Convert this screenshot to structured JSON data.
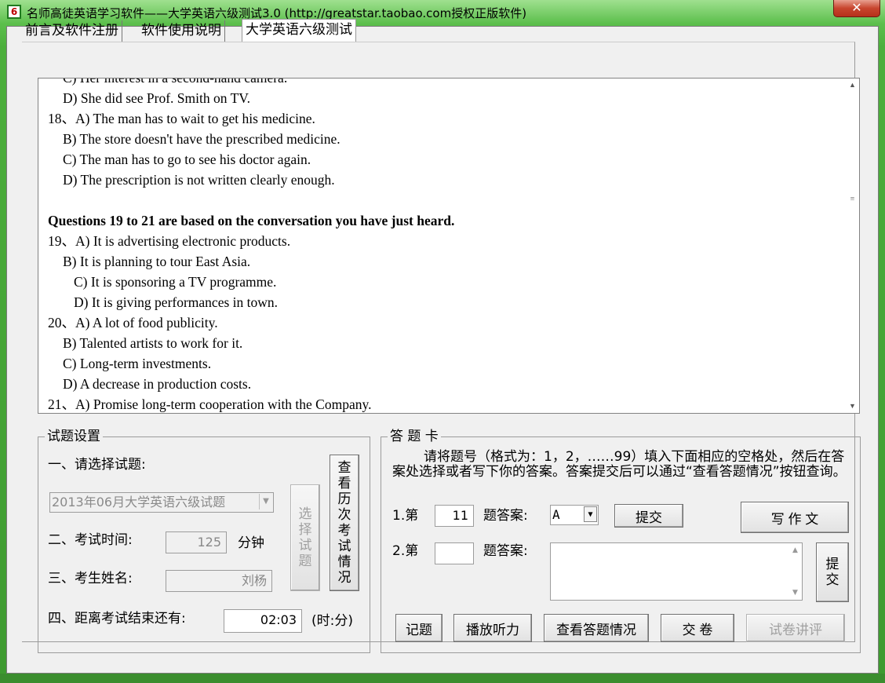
{
  "window": {
    "icon_text": "6",
    "title": "名师高徒英语学习软件——大学英语六级测试3.0 (http://greatstar.taobao.com授权正版软件)",
    "close_glyph": "✕"
  },
  "tabs": [
    {
      "label": "前言及软件注册"
    },
    {
      "label": "软件使用说明"
    },
    {
      "label": "大学英语六级测试"
    }
  ],
  "questions_text": {
    "lines": [
      {
        "text": "C) Her interest in a second-hand camera.",
        "indent": 1,
        "bold": false
      },
      {
        "text": "D) She did see Prof. Smith on TV.",
        "indent": 1,
        "bold": false
      },
      {
        "text": "18、A) The man has to wait to get his medicine.",
        "indent": 0,
        "bold": false
      },
      {
        "text": "B) The store doesn't have the prescribed medicine.",
        "indent": 1,
        "bold": false
      },
      {
        "text": "C) The man has to go to see his doctor again.",
        "indent": 1,
        "bold": false
      },
      {
        "text": "D) The prescription is not written clearly enough.",
        "indent": 1,
        "bold": false
      },
      {
        "text": "",
        "indent": 0,
        "bold": false
      },
      {
        "text": "Questions 19 to 21 are based on the conversation you have just heard.",
        "indent": 0,
        "bold": true
      },
      {
        "text": "19、A) It is advertising electronic products.",
        "indent": 0,
        "bold": false
      },
      {
        "text": "B) It is planning to tour East Asia.",
        "indent": 1,
        "bold": false
      },
      {
        "text": "C) It is sponsoring a TV programme.",
        "indent": 2,
        "bold": false
      },
      {
        "text": "D) It is giving performances in town.",
        "indent": 2,
        "bold": false
      },
      {
        "text": "20、A) A lot of food publicity.",
        "indent": 0,
        "bold": false
      },
      {
        "text": "B) Talented artists to work for it.",
        "indent": 1,
        "bold": false
      },
      {
        "text": "C) Long-term investments.",
        "indent": 1,
        "bold": false
      },
      {
        "text": "D) A decrease in production costs.",
        "indent": 1,
        "bold": false
      },
      {
        "text": "21、A) Promise long-term cooperation with the Company.",
        "indent": 0,
        "bold": false
      }
    ]
  },
  "test_settings": {
    "title": "试题设置",
    "select_label": "一、请选择试题:",
    "selected_exam": "2013年06月大学英语六级试题",
    "time_label": "二、考试时间:",
    "time_value": "125",
    "time_unit": "分钟",
    "name_label": "三、考生姓名:",
    "name_value": "刘杨",
    "remaining_label": "四、距离考试结束还有:",
    "remaining_value": "02:03",
    "remaining_unit": "(时:分)",
    "select_button": "选择试题",
    "history_button": "查看历次考试情况"
  },
  "answer_card": {
    "title": "答 题 卡",
    "instructions": "请将题号（格式为：1，2，……99）填入下面相应的空格处，然后在答案处选择或者写下你的答案。答案提交后可以通过“查看答题情况”按钮查询。",
    "row1_prefix": "1.第",
    "row1_number": "11",
    "row1_suffix": "题答案:",
    "row1_answer": "A",
    "row1_submit": "提交",
    "row2_prefix": "2.第",
    "row2_number": "",
    "row2_suffix": "题答案:",
    "row2_submit": "提交",
    "write_essay": "写   作   文",
    "buttons": {
      "note": "记题",
      "play": "播放听力",
      "check": "查看答题情况",
      "handin": "交   卷",
      "review": "试卷讲评"
    }
  }
}
